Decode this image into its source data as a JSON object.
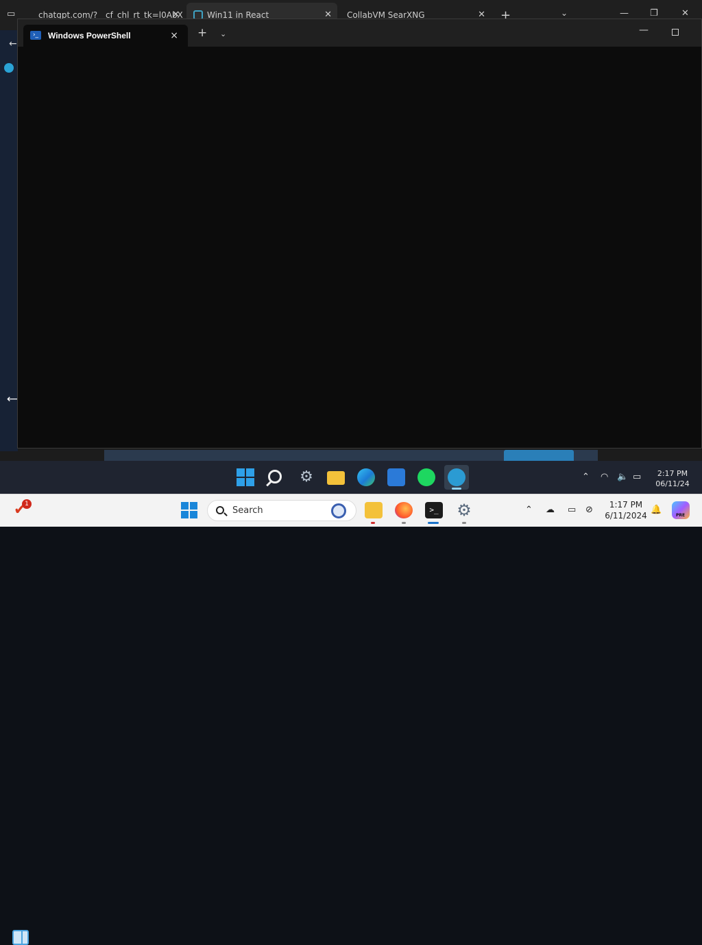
{
  "browser": {
    "tabs": [
      {
        "title": "chatgpt.com/?__cf_chl_rt_tk=l0AbX",
        "active": false
      },
      {
        "title": "Win11 in React",
        "active": true
      },
      {
        "title": "CollabVM SearXNG",
        "active": false
      }
    ],
    "new_tab_label": "+",
    "tabs_dropdown_icon": "chevron-down-icon",
    "window_controls": [
      "minimize-icon",
      "restore-icon",
      "close-icon"
    ]
  },
  "terminal": {
    "tab_title": "Windows PowerShell",
    "new_tab_label": "+",
    "close_label": "×",
    "dropdown_label": "⌄",
    "accent": "#1f5fb8"
  },
  "vm_taskbar": {
    "clock": {
      "time": "2:17 PM",
      "date": "06/11/24"
    },
    "apps": [
      "start-icon",
      "search-icon",
      "settings-icon",
      "file-explorer-icon",
      "edge-icon",
      "store-icon",
      "spotify-icon",
      "app-icon"
    ]
  },
  "host_taskbar": {
    "search_placeholder": "Search",
    "notification_badge": "1",
    "clock": {
      "time": "1:17 PM",
      "date": "6/11/2024"
    },
    "copilot_badge": "PRE"
  }
}
